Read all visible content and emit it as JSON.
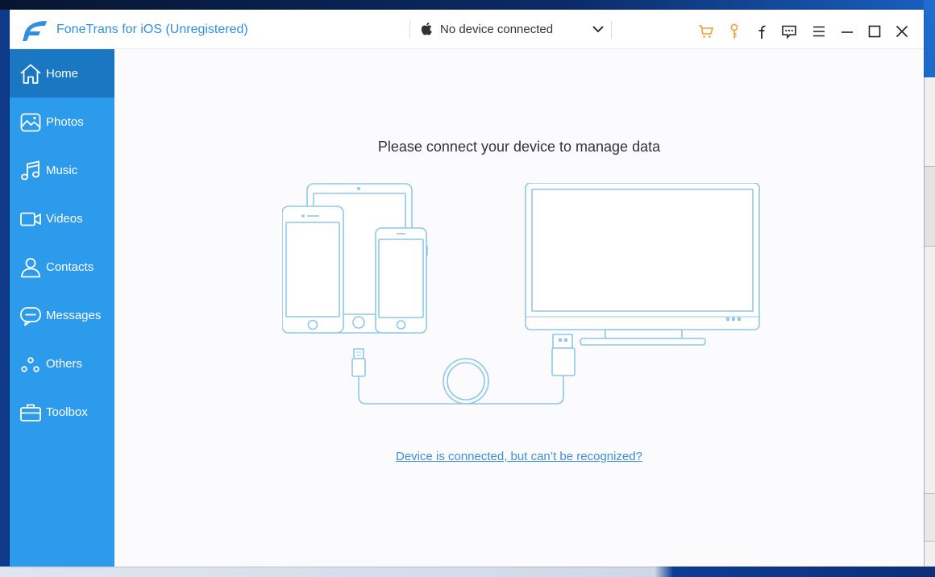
{
  "app": {
    "title": "FoneTrans for iOS (Unregistered)",
    "brand_color": "#2f8fe0",
    "sidebar_color": "#2d9bec",
    "sidebar_active_color": "#1a78c2",
    "logo_icon": "fonetrans-logo-icon"
  },
  "device_selector": {
    "label": "No device connected",
    "icon": "apple-icon"
  },
  "toolbar": {
    "icons": [
      "cart-icon",
      "key-icon",
      "facebook-icon",
      "feedback-icon",
      "menu-icon",
      "minimize-icon",
      "maximize-icon",
      "close-icon"
    ]
  },
  "sidebar": {
    "items": [
      {
        "label": "Home",
        "icon": "home-icon",
        "active": true
      },
      {
        "label": "Photos",
        "icon": "photos-icon",
        "active": false
      },
      {
        "label": "Music",
        "icon": "music-icon",
        "active": false
      },
      {
        "label": "Videos",
        "icon": "videos-icon",
        "active": false
      },
      {
        "label": "Contacts",
        "icon": "contacts-icon",
        "active": false
      },
      {
        "label": "Messages",
        "icon": "messages-icon",
        "active": false
      },
      {
        "label": "Others",
        "icon": "others-icon",
        "active": false
      },
      {
        "label": "Toolbox",
        "icon": "toolbox-icon",
        "active": false
      }
    ]
  },
  "main": {
    "prompt": "Please connect your device to manage data",
    "help_link": "Device is connected, but can’t be recognized?",
    "link_color": "#3e8fd8",
    "illustration_color": "#8fc7ea"
  }
}
